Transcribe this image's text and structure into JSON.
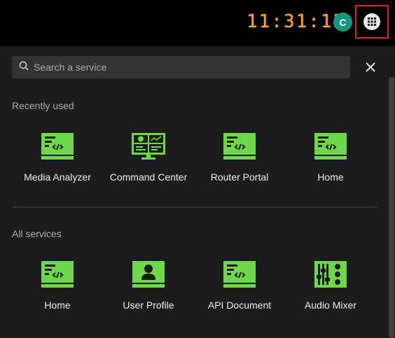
{
  "header": {
    "clock": "11:31:15",
    "avatar_initial": "C"
  },
  "search": {
    "placeholder": "Search a service"
  },
  "recent": {
    "title": "Recently used",
    "items": [
      {
        "label": "Media Analyzer",
        "icon": "code-monitor-icon"
      },
      {
        "label": "Command Center",
        "icon": "dashboard-monitor-icon"
      },
      {
        "label": "Router Portal",
        "icon": "code-monitor-icon"
      },
      {
        "label": "Home",
        "icon": "code-monitor-icon"
      }
    ]
  },
  "all": {
    "title": "All services",
    "items": [
      {
        "label": "Home",
        "icon": "code-monitor-icon"
      },
      {
        "label": "User Profile",
        "icon": "user-profile-icon"
      },
      {
        "label": "API Document",
        "icon": "code-monitor-icon"
      },
      {
        "label": "Audio Mixer",
        "icon": "mixer-icon"
      }
    ]
  },
  "colors": {
    "accent_green": "#6fd84a",
    "avatar_bg": "#17967f",
    "clock": "#f2a33a",
    "highlight_border": "#e31b1b"
  }
}
